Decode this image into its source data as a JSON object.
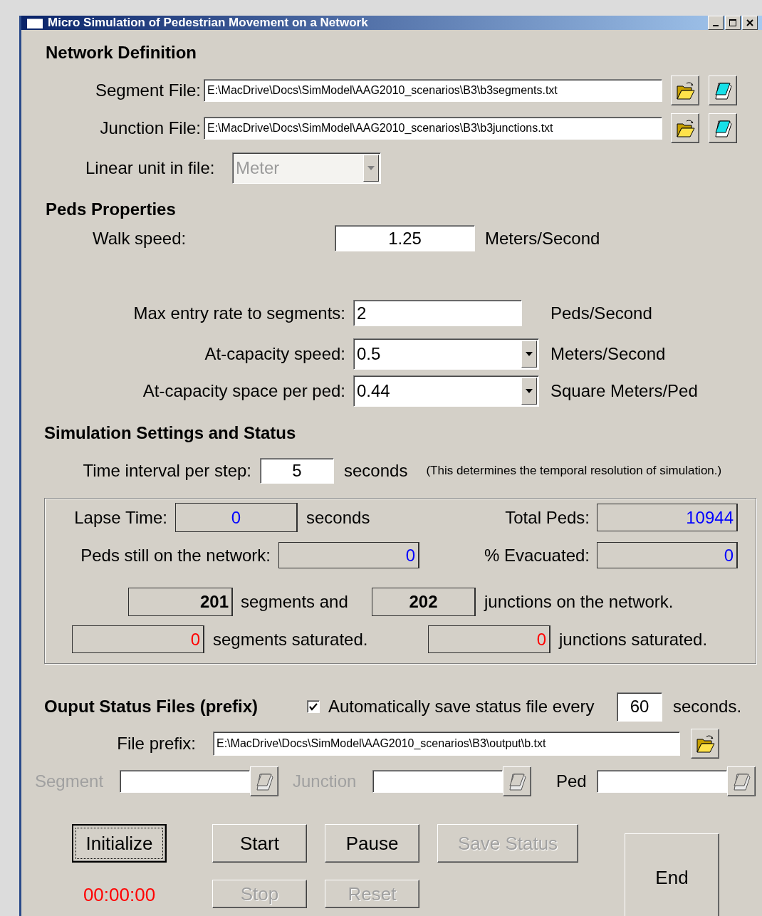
{
  "window": {
    "title": "Micro Simulation of Pedestrian Movement on a Network"
  },
  "network_definition": {
    "heading": "Network Definition",
    "files": [
      {
        "label": "Segment File:",
        "value": "E:\\MacDrive\\Docs\\SimModel\\AAG2010_scenarios\\B3\\b3segments.txt"
      },
      {
        "label": "Junction File:",
        "value": "E:\\MacDrive\\Docs\\SimModel\\AAG2010_scenarios\\B3\\b3junctions.txt"
      }
    ],
    "linear_unit": {
      "label": "Linear unit in file:",
      "value": "Meter",
      "disabled": true
    }
  },
  "peds_properties": {
    "heading": "Peds Properties",
    "walk_speed": {
      "label": "Walk speed:",
      "value": "1.25",
      "unit": "Meters/Second"
    },
    "parameters": [
      {
        "kind": "text",
        "label": "Max entry rate to segments:",
        "value": "2",
        "unit": "Peds/Second"
      },
      {
        "kind": "combo",
        "label": "At-capacity speed:",
        "value": "0.5",
        "unit": "Meters/Second"
      },
      {
        "kind": "combo",
        "label": "At-capacity space per ped:",
        "value": "0.44",
        "unit": "Square Meters/Ped"
      }
    ]
  },
  "simulation": {
    "heading": "Simulation Settings and Status",
    "time_interval": {
      "label": "Time interval per step:",
      "value": "5",
      "unit": "seconds",
      "note": "(This determines the temporal resolution of simulation.)"
    },
    "status": {
      "lapse_time": {
        "label": "Lapse Time:",
        "value": "0",
        "unit": "seconds",
        "color": "#0000ff"
      },
      "total_peds": {
        "label": "Total Peds:",
        "value": "10944",
        "color": "#0000ff"
      },
      "peds_on_network": {
        "label": "Peds still on the network:",
        "value": "0",
        "color": "#0000ff"
      },
      "evacuated": {
        "label": "% Evacuated:",
        "value": "0",
        "color": "#0000ff"
      },
      "segments": {
        "value": "201",
        "text": "segments and",
        "color": "#000000"
      },
      "junctions": {
        "value": "202",
        "text": "junctions on the network.",
        "color": "#000000"
      },
      "segments_saturated": {
        "value": "0",
        "text": "segments saturated.",
        "color": "#ff0000"
      },
      "junctions_saturated": {
        "value": "0",
        "text": "junctions saturated.",
        "color": "#ff0000"
      }
    }
  },
  "output": {
    "heading": "Ouput Status Files (prefix)",
    "auto_save": {
      "label": "Automatically save status file every",
      "checked": true,
      "value": "60",
      "unit": "seconds."
    },
    "file_prefix": {
      "label": "File prefix:",
      "value": "E:\\MacDrive\\Docs\\SimModel\\AAG2010_scenarios\\B3\\output\\b.txt"
    },
    "logs": [
      {
        "label": "Segment",
        "disabled": true
      },
      {
        "label": "Junction",
        "disabled": true
      },
      {
        "label": "Ped",
        "disabled": false
      }
    ]
  },
  "buttons": [
    {
      "label": "Initialize",
      "disabled": false,
      "focused": true
    },
    {
      "label": "Start",
      "disabled": false,
      "focused": false
    },
    {
      "label": "Pause",
      "disabled": false,
      "focused": false
    },
    {
      "label": "Save Status",
      "disabled": true,
      "focused": false
    },
    {
      "label": "End",
      "disabled": false,
      "focused": false
    },
    {
      "label": "Stop",
      "disabled": true,
      "focused": false
    },
    {
      "label": "Reset",
      "disabled": true,
      "focused": false
    }
  ],
  "timer": "00:00:00"
}
